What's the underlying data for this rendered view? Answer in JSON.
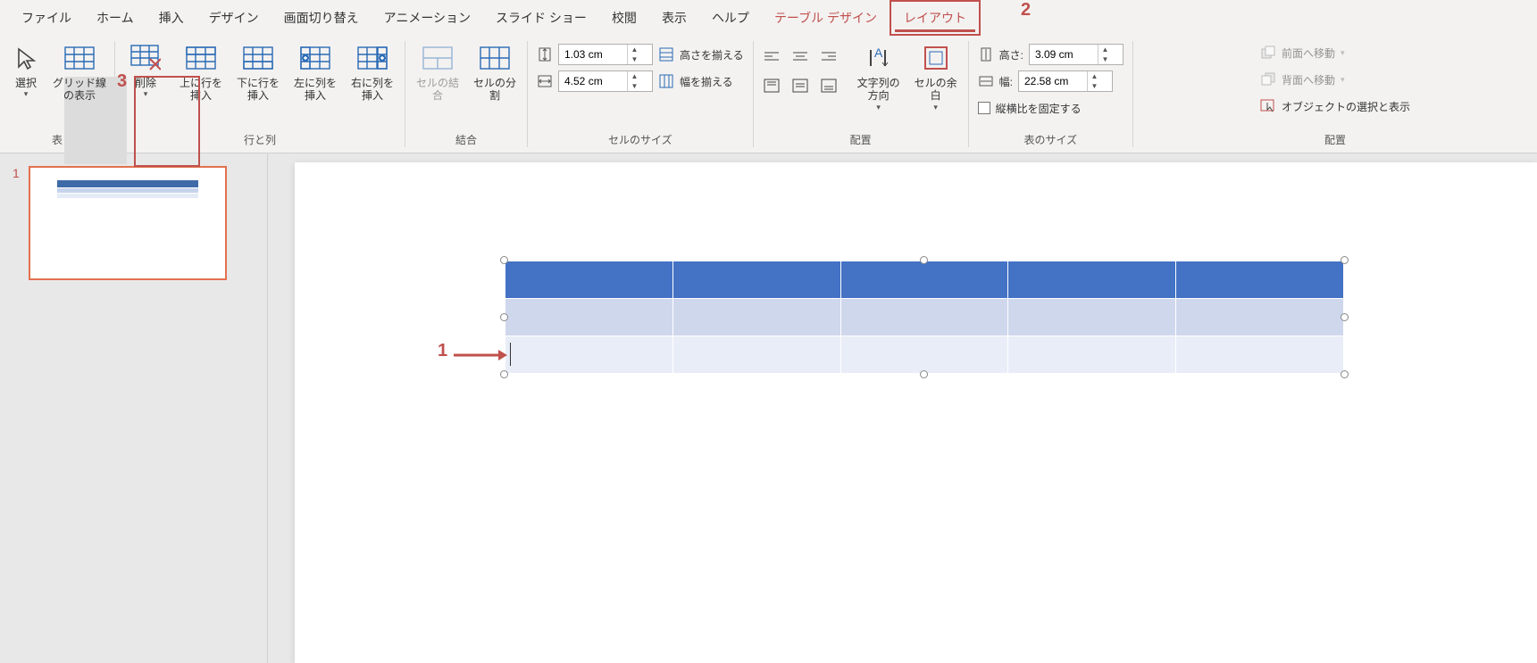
{
  "tabs": {
    "file": "ファイル",
    "home": "ホーム",
    "insert": "挿入",
    "design": "デザイン",
    "transition": "画面切り替え",
    "animation": "アニメーション",
    "slideshow": "スライド ショー",
    "review": "校閲",
    "view": "表示",
    "help": "ヘルプ",
    "tabledesign": "テーブル デザイン",
    "layout": "レイアウト"
  },
  "groups": {
    "table": "表",
    "rowscols": "行と列",
    "merge": "結合",
    "cellsize": "セルのサイズ",
    "align": "配置",
    "tablesize": "表のサイズ",
    "arrange": "配置"
  },
  "btn": {
    "select": "選択",
    "gridlines": "グリッド線の表示",
    "delete": "削除",
    "insabove": "上に行を挿入",
    "insbelow": "下に行を挿入",
    "insleft": "左に列を挿入",
    "insright": "右に列を挿入",
    "mergecells": "セルの結合",
    "splitcells": "セルの分割",
    "distrows": "高さを揃える",
    "distcols": "幅を揃える",
    "textdir": "文字列の方向",
    "cellmargin": "セルの余白",
    "heightlbl": "高さ:",
    "widthlbl": "幅:",
    "lockar": "縦横比を固定する",
    "bringfwd": "前面へ移動",
    "sendback": "背面へ移動",
    "selpane": "オブジェクトの選択と表示"
  },
  "vals": {
    "cellh": "1.03 cm",
    "cellw": "4.52 cm",
    "tblh": "3.09 cm",
    "tblw": "22.58 cm"
  },
  "anno": {
    "n1": "1",
    "n2": "2",
    "n3": "3"
  },
  "thumb": {
    "num": "1"
  }
}
